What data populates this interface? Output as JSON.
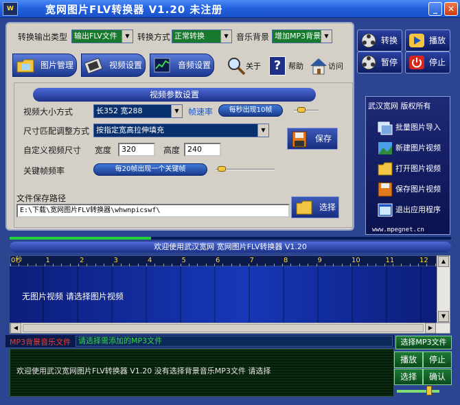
{
  "window": {
    "title": "宽网图片FLV转换器  V1.20 未注册",
    "icon_label": "W",
    "minimize_glyph": "_",
    "close_glyph": "✕"
  },
  "options": {
    "output_type_label": "转换输出类型",
    "output_type_value": "输出FLV文件",
    "convert_mode_label": "转换方式",
    "convert_mode_value": "正常转换",
    "music_label": "音乐背景",
    "music_value": "增加MP3背景"
  },
  "tabs": [
    {
      "label": "图片管理"
    },
    {
      "label": "视频设置"
    },
    {
      "label": "音频设置"
    }
  ],
  "mini_buttons": {
    "about": "关于",
    "help": "帮助",
    "visit": "访问"
  },
  "video_params": {
    "group_title": "视频参数设置",
    "size_mode_label": "视频大小方式",
    "size_mode_value": "长352 宽288",
    "fps_label": "帧速率",
    "fps_value": "每秒出现10帧",
    "fps_slider_pct": 0.3,
    "fit_label": "尺寸匹配调整方式",
    "fit_value": "按指定宽高拉伸填充",
    "custom_size_label": "自定义视频尺寸",
    "width_label": "宽度",
    "width_value": "320",
    "height_label": "高度",
    "height_value": "240",
    "save_label": "保存",
    "keyframe_label": "关键帧频率",
    "keyframe_value": "每20帧出现一个关键帧",
    "keyframe_slider_pct": 0.1,
    "path_label": "文件保存路径",
    "path_value": "E:\\下载\\宽网图片FLV转换器\\whwnpicswf\\",
    "browse_label": "选择"
  },
  "controls": {
    "convert": "转换",
    "play": "播放",
    "pause": "暂停",
    "stop": "停止"
  },
  "side_panel": {
    "header": "武汉宽网 版权所有",
    "items": [
      "批量图片导入",
      "新建图片视频",
      "打开图片视频",
      "保存图片视频",
      "退出应用程序"
    ],
    "footer": "www.mpegnet.cn"
  },
  "progress_pct": 0.32,
  "banner": "欢迎使用武汉宽网 宽网图片FLV转换器 V1.20",
  "timeline": {
    "ticks": [
      "0秒",
      "1",
      "2",
      "3",
      "4",
      "5",
      "6",
      "7",
      "8",
      "9",
      "10",
      "11",
      "12"
    ]
  },
  "preview_message": "无图片视频 请选择图片视频",
  "mp3": {
    "label": "MP3背景音乐文件",
    "field_value": "请选择需添加的MP3文件",
    "select_button": "选择MP3文件"
  },
  "status_message": "欢迎使用武汉宽网图片FLV转换器 V1.20 没有选择背景音乐MP3文件 请选择",
  "audio_buttons": {
    "play": "播放",
    "stop": "停止",
    "select": "选择",
    "confirm": "确认"
  },
  "volume_pct": 0.75,
  "colors": {
    "accent": "#1d3288",
    "title_bar": "#2463e0",
    "status_bg": "#071e0b",
    "status_button": "#1d7a34"
  }
}
